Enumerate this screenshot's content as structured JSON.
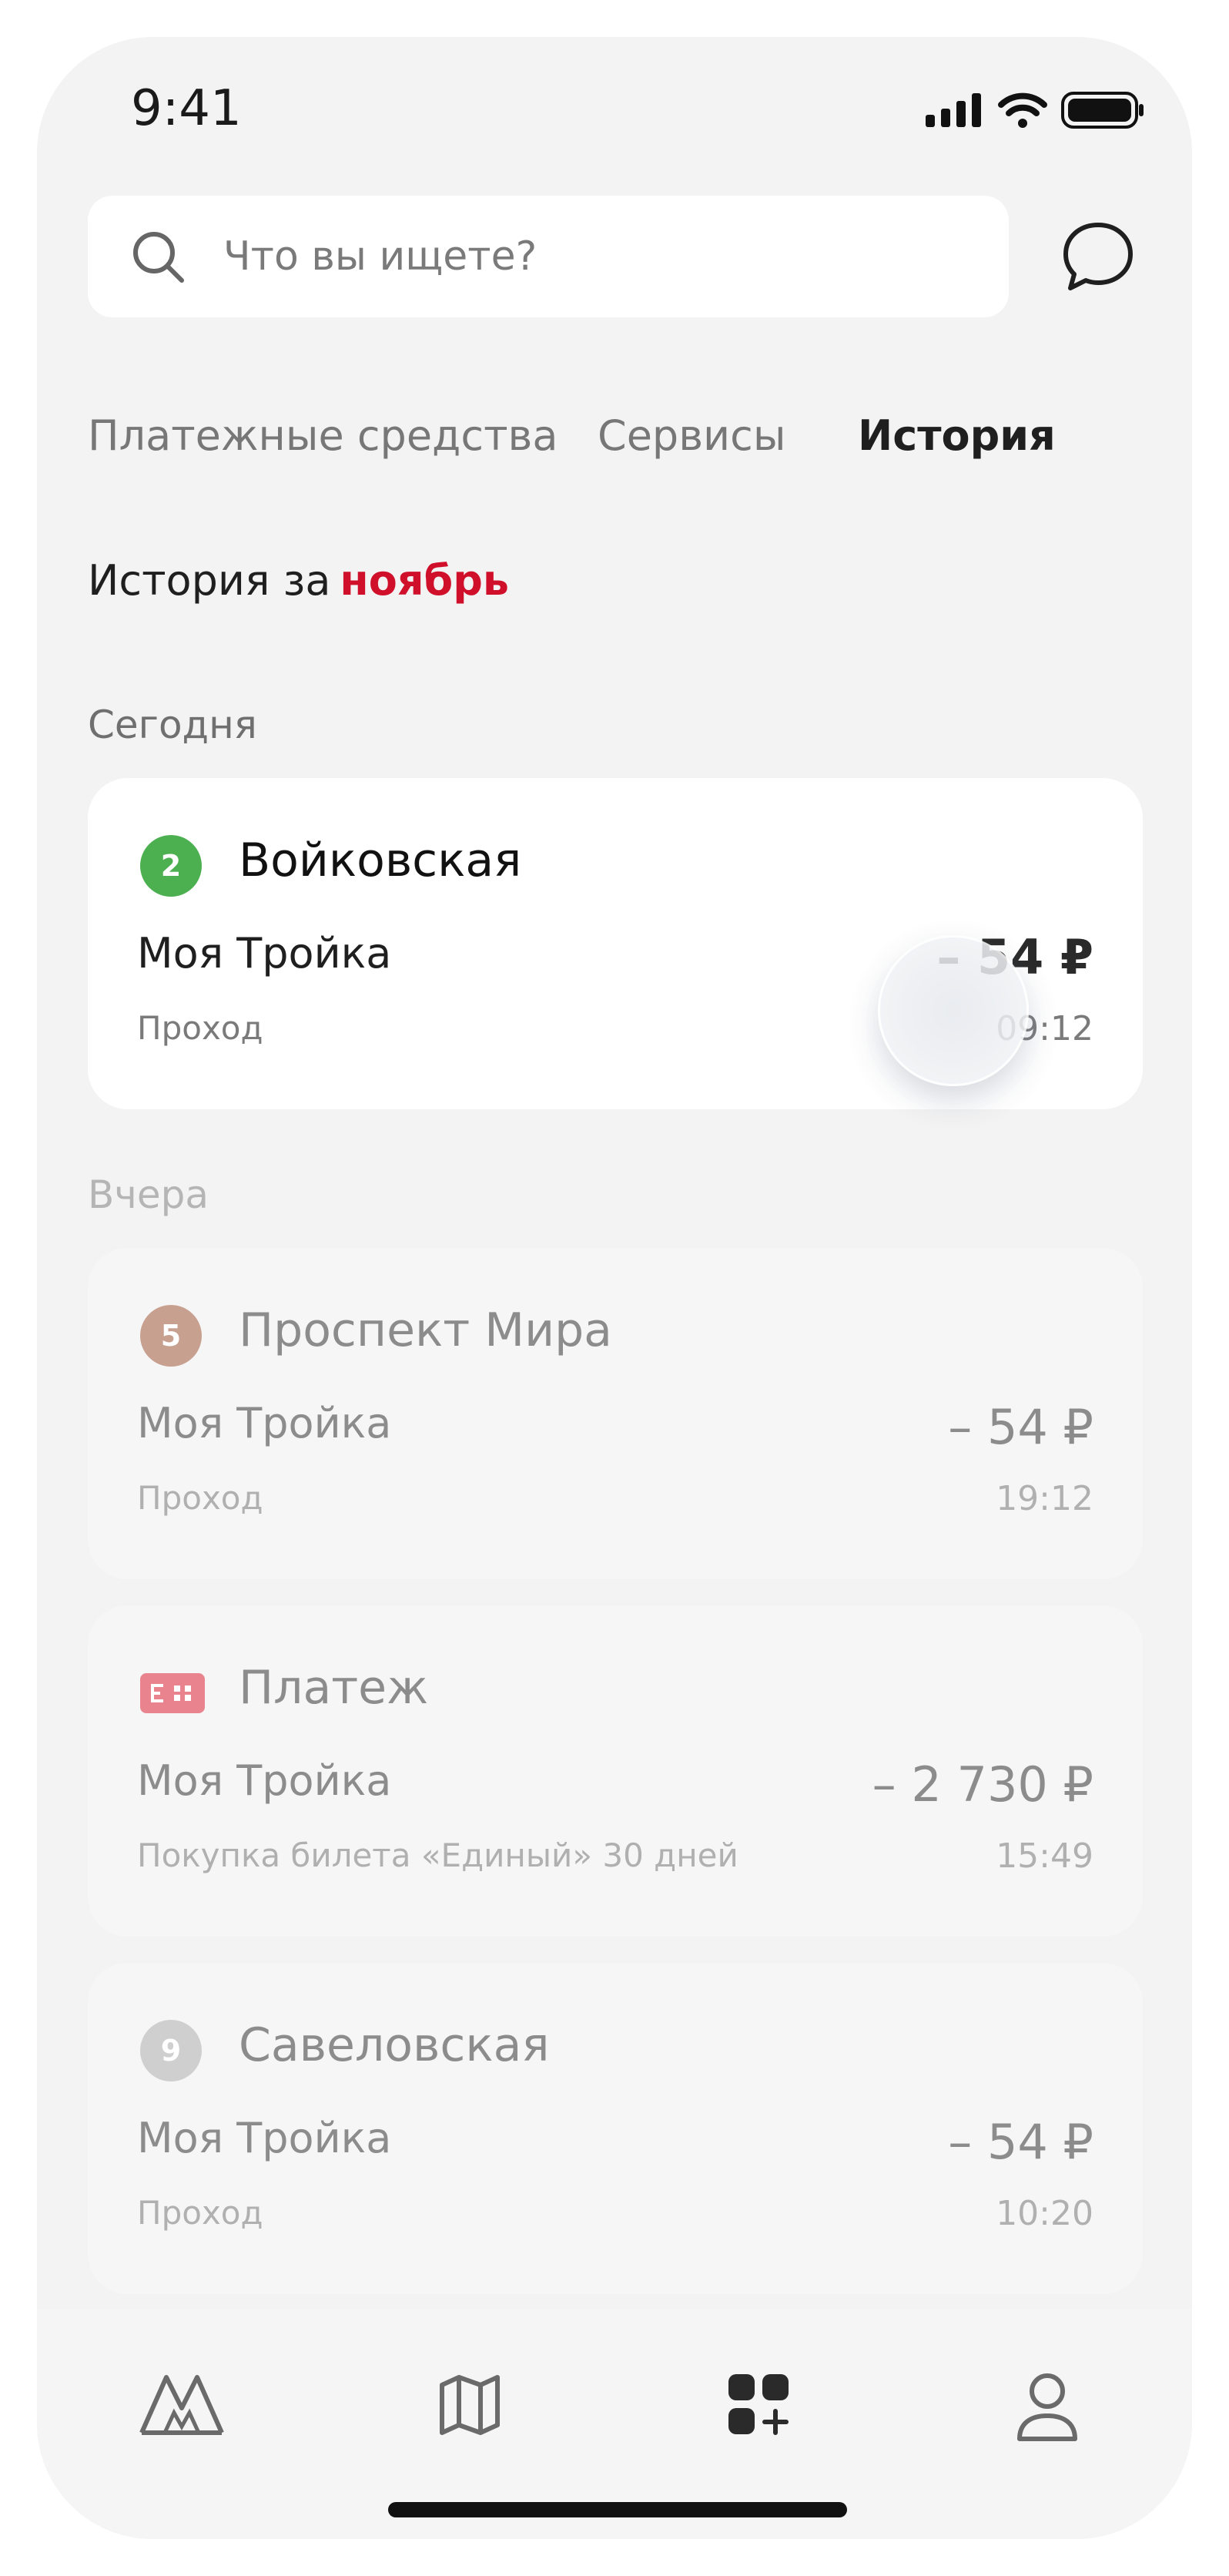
{
  "status_bar": {
    "time": "9:41",
    "icons": [
      "signal-icon",
      "wifi-icon",
      "battery-icon"
    ]
  },
  "search": {
    "placeholder": "Что вы ищете?"
  },
  "header_icons": [
    "search-icon",
    "chat-icon"
  ],
  "tabs": [
    {
      "label": "Платежные средства",
      "active": false
    },
    {
      "label": "Сервисы",
      "active": false
    },
    {
      "label": "История",
      "active": true
    }
  ],
  "history": {
    "prefix": "История за",
    "month": "ноябрь"
  },
  "sections": [
    {
      "label": "Сегодня",
      "items": [
        {
          "icon": "metro-line-badge",
          "line": "2",
          "line_color": "#4caf50",
          "title": "Войковская",
          "product": "Моя Тройка",
          "kind": "Проход",
          "amount": "– 54 ₽",
          "time": "09:12"
        }
      ]
    },
    {
      "label": "Вчера",
      "items": [
        {
          "icon": "metro-line-badge",
          "line": "5",
          "line_color": "#c7a08f",
          "title": "Проспект Мира",
          "product": "Моя Тройка",
          "kind": "Проход",
          "amount": "– 54 ₽",
          "time": "19:12"
        },
        {
          "icon": "payment-card-icon",
          "icon_color": "#e9848f",
          "title": "Платеж",
          "product": "Моя Тройка",
          "kind": "Покупка билета «Единый» 30 дней",
          "amount": "– 2 730 ₽",
          "time": "15:49"
        },
        {
          "icon": "metro-line-badge",
          "line": "9",
          "line_color": "#cfcfcf",
          "title": "Савеловская",
          "product": "Моя Тройка",
          "kind": "Проход",
          "amount": "– 54 ₽",
          "time": "10:20"
        }
      ]
    }
  ],
  "tabbar": [
    {
      "icon": "metro-logo-icon"
    },
    {
      "icon": "map-icon"
    },
    {
      "icon": "services-grid-icon",
      "active": true
    },
    {
      "icon": "profile-icon"
    }
  ],
  "colors": {
    "background": "#f3f3f3",
    "accent_red": "#d0102a",
    "line2": "#4caf50",
    "line5": "#c7a08f",
    "line9": "#cfcfcf"
  }
}
